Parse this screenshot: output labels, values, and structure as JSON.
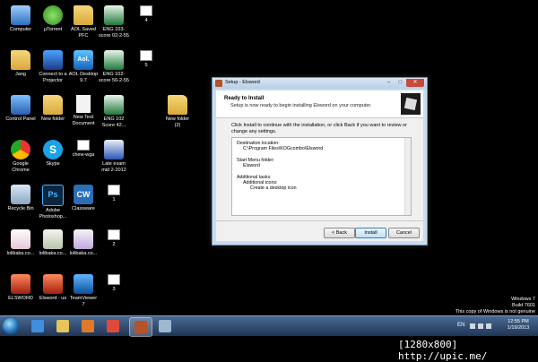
{
  "desktop": {
    "icons": [
      {
        "label": "Computer",
        "kind": "computer"
      },
      {
        "label": "µTorrent",
        "kind": "utorrent"
      },
      {
        "label": "AOL Saved PFC",
        "kind": "folder"
      },
      {
        "label": "ENG 103-score 02-2-55",
        "kind": "excel"
      },
      {
        "label": "4",
        "kind": "shortcut"
      },
      {
        "label": "Jang",
        "kind": "folder"
      },
      {
        "label": "Connect to a Projector",
        "kind": "projector"
      },
      {
        "label": "AOL Desktop 9.7",
        "kind": "aol",
        "glyph": "Aol."
      },
      {
        "label": "ENG 102-score 56-2-55",
        "kind": "excel"
      },
      {
        "label": "5",
        "kind": "shortcut"
      },
      {
        "label": "Control Panel",
        "kind": "cp"
      },
      {
        "label": "New folder",
        "kind": "folder"
      },
      {
        "label": "New Text Document",
        "kind": "blank"
      },
      {
        "label": "ENG 102 Score 42...",
        "kind": "excel"
      },
      {
        "label": "New folder (2)",
        "kind": "folder"
      },
      {
        "label": "Google Chrome",
        "kind": "chrome"
      },
      {
        "label": "Skype",
        "kind": "skype",
        "glyph": "S"
      },
      {
        "label": "chew-wga",
        "kind": "shortcut"
      },
      {
        "label": "Late exam mid 2-2012",
        "kind": "word"
      },
      {
        "label": "Recycle Bin",
        "kind": "recycle"
      },
      {
        "label": "Adobe Photoshop...",
        "kind": "ps",
        "glyph": "Ps"
      },
      {
        "label": "Classware",
        "kind": "cw",
        "glyph": "CW"
      },
      {
        "label": "1",
        "kind": "shortcut"
      },
      {
        "label": "lolibaka.co...",
        "kind": "anime1"
      },
      {
        "label": "lolibaka.co...",
        "kind": "anime2"
      },
      {
        "label": "lolibaka.co...",
        "kind": "anime3"
      },
      {
        "label": "2",
        "kind": "shortcut"
      },
      {
        "label": "ELSWORD",
        "kind": "elsword"
      },
      {
        "label": "Elsword - us",
        "kind": "elsword"
      },
      {
        "label": "TeamViewer 7",
        "kind": "tv"
      },
      {
        "label": "3",
        "kind": "shortcut"
      }
    ]
  },
  "dialog": {
    "title": "Setup - Elsword",
    "window_buttons": {
      "min": "–",
      "max": "□",
      "close": "✕"
    },
    "heading": "Ready to Install",
    "subheading": "Setup is now ready to begin installing Elsword on your computer.",
    "intro": "Click Install to continue with the installation, or click Back if you want to review or change any settings.",
    "memo": {
      "dest_label": "Destination location:",
      "dest_value": "C:\\Program Files\\KOGcombo\\Elsword",
      "menu_label": "Start Menu folder:",
      "menu_value": "Elsword",
      "tasks_label": "Additional tasks:",
      "icons_label": "Additional icons:",
      "icons_value": "Create a desktop icon"
    },
    "buttons": {
      "back": "< Back",
      "install": "Install",
      "cancel": "Cancel"
    }
  },
  "watermark": {
    "line1": "Windows 7",
    "line2": "Build 7601",
    "line3": "This copy of Windows is not genuine"
  },
  "taskbar": {
    "language": "EN",
    "time": "12:55 PM",
    "date": "1/19/2013",
    "items": [
      {
        "name": "ie",
        "color": "#3f8fe0"
      },
      {
        "name": "explorer",
        "color": "#e8c45a"
      },
      {
        "name": "media-player",
        "color": "#e07a2a"
      },
      {
        "name": "chrome",
        "color": "#e04a3a"
      },
      {
        "name": "elsword-setup",
        "color": "#b4522a"
      },
      {
        "name": "network",
        "color": "#9fb8d0"
      }
    ]
  },
  "footer": {
    "text": "[1280x800] http://upic.me/"
  }
}
